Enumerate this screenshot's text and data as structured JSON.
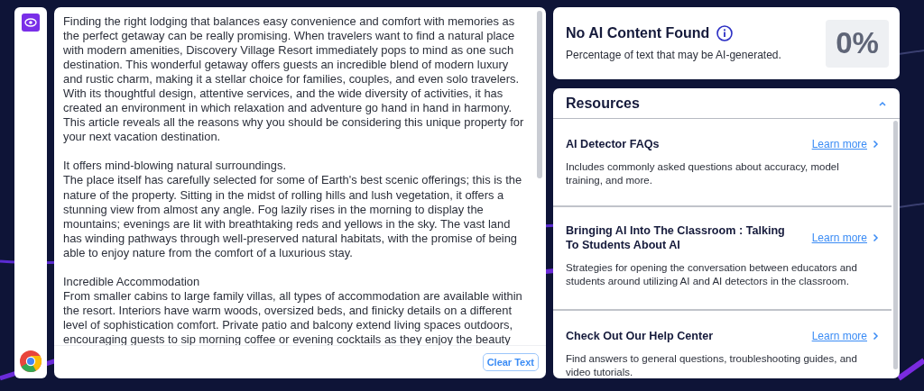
{
  "editor": {
    "sections": [
      [
        {
          "lines": [
            "Finding the right lodging that balances easy convenience and comfort with memories as",
            "the perfect getaway can be really promising. When travelers want to find a natural place",
            "with modern amenities, Discovery Village Resort immediately pops to mind as one such",
            "destination. This wonderful getaway offers guests an incredible blend of modern luxury",
            "and rustic charm, making it a stellar choice for families, couples, and even solo travelers.",
            "With its thoughtful design, attentive services, and the wide diversity of activities, it has",
            "created an environment in which relaxation and adventure go hand in hand in harmony.",
            "This article reveals all the reasons why you should be considering this unique property for",
            "your next vacation destination."
          ]
        }
      ],
      [
        {
          "lines": [
            "It offers mind-blowing natural surroundings."
          ]
        },
        {
          "lines": [
            "The place itself has carefully selected for some of Earth's best scenic offerings; this is the",
            "nature of the property. Sitting in the midst of rolling hills and lush vegetation, it offers a",
            "stunning view from almost any angle. Fog lazily rises in the morning to display the",
            "mountains; evenings are lit with breathtaking reds and yellows in the sky. The vast land",
            "has winding pathways through well-preserved natural habitats, with the promise of being",
            "able to enjoy nature from the comfort of a luxurious stay."
          ]
        }
      ],
      [
        {
          "lines": [
            "Incredible Accommodation"
          ]
        },
        {
          "lines": [
            "From smaller cabins to large family villas, all types of accommodation are available within",
            "the resort. Interiors have warm woods, oversized beds, and finicky details on a different",
            "level of sophistication comfort. Private patio and balcony extend living spaces outdoors,",
            "encouraging guests to sip morning coffee or evening cocktails as they enjoy the beauty"
          ]
        }
      ]
    ],
    "clear_button": "Clear Text"
  },
  "result": {
    "title": "No AI Content Found",
    "subtitle": "Percentage of text that may be AI-generated.",
    "score": "0%"
  },
  "resources": {
    "title": "Resources",
    "expanded": true,
    "items": [
      {
        "title": "AI Detector FAQs",
        "link": "Learn more",
        "description": "Includes commonly asked questions about accuracy, model training, and more."
      },
      {
        "title": "Bringing AI Into The Classroom : Talking To Students About AI",
        "link": "Learn more",
        "description": "Strategies for opening the conversation between educators and students around utilizing AI and AI detectors in the classroom."
      },
      {
        "title": "Check Out Our Help Center",
        "link": "Learn more",
        "description": "Find answers to general questions, troubleshooting guides, and video tutorials."
      }
    ]
  }
}
